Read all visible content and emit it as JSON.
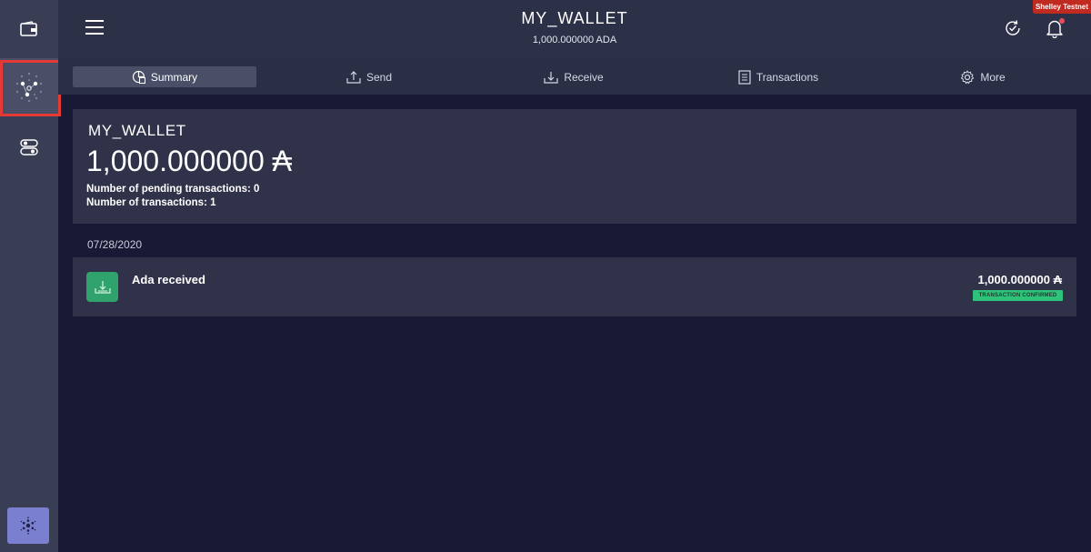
{
  "network_badge": "Shelley Testnet",
  "topbar": {
    "wallet_name": "MY_WALLET",
    "balance": "1,000.000000 ADA"
  },
  "tabs": [
    {
      "label": "Summary",
      "icon": "summary-icon",
      "active": true
    },
    {
      "label": "Send",
      "icon": "send-icon",
      "active": false
    },
    {
      "label": "Receive",
      "icon": "receive-icon",
      "active": false
    },
    {
      "label": "Transactions",
      "icon": "transactions-icon",
      "active": false
    },
    {
      "label": "More",
      "icon": "gear-icon",
      "active": false
    }
  ],
  "summary": {
    "wallet_name": "MY_WALLET",
    "amount": "1,000.000000 ₳",
    "pending_transactions": "Number of pending transactions: 0",
    "total_transactions": "Number of transactions: 1"
  },
  "transactions": {
    "date": "07/28/2020",
    "items": [
      {
        "title": "Ada received",
        "amount": "1,000.000000 ₳",
        "status": "TRANSACTION CONFIRMED"
      }
    ]
  },
  "colors": {
    "sidebar": "#3a3e55",
    "topbar": "#2d3148",
    "background": "#181a35",
    "card": "#2f3249",
    "highlight": "#e53935",
    "received_green": "#2fa36b",
    "network_badge": "#c02a20"
  }
}
